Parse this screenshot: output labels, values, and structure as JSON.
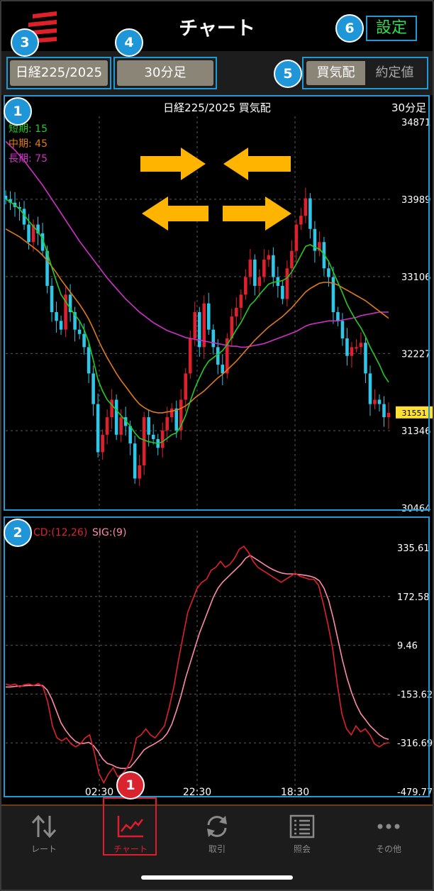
{
  "header": {
    "title": "チャート",
    "settings_label": "設定"
  },
  "toolbar": {
    "symbol_label": "日経225/2025",
    "interval_label": "30分足",
    "segment": {
      "bid_label": "買気配",
      "trade_label": "約定値"
    }
  },
  "badges": {
    "b1": "1",
    "b2": "2",
    "b3": "3",
    "b4": "4",
    "b5": "5",
    "b6": "6",
    "b7": "1"
  },
  "main_chart": {
    "header_title": "日経225/2025 買気配",
    "interval_label": "30分足",
    "ma_labels": {
      "short": "短期: 15",
      "mid": "中期: 45",
      "long": "長期: 75"
    },
    "price_ticks": [
      "34871",
      "33989",
      "33106",
      "32227",
      "31346",
      "30464"
    ],
    "current_price": "31551"
  },
  "macd_chart": {
    "label_macd": "CD:(12,26)",
    "label_sig": "SIG:(9)",
    "value_ticks": [
      "335.61",
      "172.58",
      "9.46",
      "-153.62",
      "-316.69",
      "-479.77"
    ],
    "time_ticks": [
      "02:30",
      "22:30",
      "18:30"
    ]
  },
  "tabs": [
    {
      "label": "レート",
      "icon": "arrows-updown-icon"
    },
    {
      "label": "チャート",
      "icon": "chart-line-icon"
    },
    {
      "label": "取引",
      "icon": "refresh-icon"
    },
    {
      "label": "照会",
      "icon": "list-icon"
    },
    {
      "label": "その他",
      "icon": "more-dots-icon"
    }
  ],
  "colors": {
    "accent_blue": "#1e9ad6",
    "settings_green": "#2edc52",
    "candle_up": "#e0202e",
    "candle_down": "#2ec7e8",
    "ma_short": "#22cc22",
    "ma_mid": "#e07a18",
    "ma_long": "#d030c8",
    "macd": "#e0202e",
    "signal": "#ff8aa8",
    "arrow": "#ffb400",
    "tab_active": "#e11d2d"
  },
  "chart_data": [
    {
      "type": "candlestick",
      "title": "日経225/2025 買気配",
      "ylim": [
        30464,
        34871
      ],
      "yticks": [
        34871,
        33989,
        33106,
        32227,
        31346,
        30464
      ],
      "xticks": [
        "02:30",
        "22:30",
        "18:30"
      ],
      "current_price": 31551,
      "ma_periods": {
        "short": 15,
        "mid": 45,
        "long": 75
      },
      "close": [
        33990,
        33950,
        33900,
        33880,
        33700,
        33500,
        33700,
        33600,
        33400,
        33000,
        32700,
        32600,
        32500,
        32900,
        32700,
        32500,
        32450,
        32300,
        32000,
        31650,
        31100,
        31300,
        31500,
        31700,
        31300,
        31500,
        31400,
        31200,
        30800,
        30950,
        31500,
        31300,
        31250,
        31150,
        31350,
        31500,
        31600,
        31350,
        31700,
        32000,
        32400,
        32700,
        32300,
        32800,
        32500,
        32300,
        32100,
        32000,
        32400,
        32650,
        32750,
        32900,
        33100,
        33300,
        33000,
        33100,
        33300,
        33350,
        33100,
        33000,
        32850,
        33200,
        33400,
        33700,
        33800,
        34000,
        33650,
        33400,
        33500,
        33200,
        33100,
        32700,
        32600,
        32400,
        32200,
        32300,
        32300,
        32350,
        32000,
        31650,
        31700,
        31650,
        31500,
        31550
      ],
      "ma_short": [
        33990,
        33960,
        33920,
        33880,
        33810,
        33740,
        33680,
        33620,
        33540,
        33380,
        33210,
        33050,
        32900,
        32820,
        32740,
        32670,
        32600,
        32500,
        32360,
        32150,
        31930,
        31800,
        31700,
        31640,
        31580,
        31520,
        31460,
        31400,
        31320,
        31260,
        31240,
        31220,
        31210,
        31200,
        31220,
        31260,
        31300,
        31320,
        31400,
        31520,
        31680,
        31830,
        31950,
        32060,
        32140,
        32180,
        32220,
        32260,
        32330,
        32410,
        32500,
        32580,
        32680,
        32780,
        32830,
        32900,
        32960,
        33020,
        33040,
        33050,
        33060,
        33090,
        33160,
        33250,
        33350,
        33450,
        33470,
        33440,
        33420,
        33360,
        33280,
        33160,
        33040,
        32920,
        32790,
        32690,
        32600,
        32520,
        32420,
        32300,
        32200,
        32100,
        31980,
        31900
      ],
      "ma_mid": [
        33650,
        33620,
        33590,
        33560,
        33520,
        33480,
        33440,
        33400,
        33350,
        33290,
        33220,
        33150,
        33070,
        33000,
        32930,
        32860,
        32790,
        32710,
        32620,
        32510,
        32390,
        32280,
        32180,
        32090,
        32000,
        31920,
        31850,
        31780,
        31710,
        31650,
        31610,
        31580,
        31560,
        31550,
        31550,
        31560,
        31570,
        31580,
        31600,
        31630,
        31670,
        31720,
        31760,
        31800,
        31850,
        31900,
        31950,
        31990,
        32040,
        32090,
        32140,
        32200,
        32260,
        32320,
        32380,
        32430,
        32480,
        32530,
        32570,
        32610,
        32650,
        32700,
        32750,
        32810,
        32870,
        32930,
        32970,
        33000,
        33030,
        33040,
        33040,
        33030,
        33010,
        32980,
        32950,
        32920,
        32890,
        32860,
        32830,
        32790,
        32750,
        32710,
        32670,
        32630
      ],
      "ma_long": [
        34650,
        34600,
        34550,
        34490,
        34430,
        34360,
        34290,
        34220,
        34150,
        34070,
        33990,
        33910,
        33830,
        33750,
        33670,
        33590,
        33510,
        33440,
        33370,
        33300,
        33230,
        33160,
        33090,
        33030,
        32970,
        32910,
        32850,
        32800,
        32750,
        32700,
        32660,
        32620,
        32580,
        32550,
        32520,
        32490,
        32470,
        32450,
        32430,
        32410,
        32400,
        32390,
        32380,
        32370,
        32360,
        32350,
        32340,
        32330,
        32320,
        32310,
        32310,
        32300,
        32300,
        32310,
        32320,
        32330,
        32340,
        32360,
        32380,
        32400,
        32420,
        32440,
        32460,
        32480,
        32510,
        32540,
        32560,
        32570,
        32580,
        32590,
        32600,
        32600,
        32600,
        32610,
        32620,
        32630,
        32640,
        32660,
        32670,
        32680,
        32690,
        32700,
        32700,
        32700
      ]
    },
    {
      "type": "line",
      "title": "MACD(12,26) SIG(9)",
      "ylim": [
        -479.77,
        335.61
      ],
      "yticks": [
        335.61,
        172.58,
        9.46,
        -153.62,
        -316.69,
        -479.77
      ],
      "xticks": [
        "02:30",
        "22:30",
        "18:30"
      ],
      "series": [
        {
          "name": "MACD",
          "values": [
            -120,
            -125,
            -120,
            -130,
            -122,
            -120,
            -125,
            -118,
            -130,
            -180,
            -260,
            -300,
            -310,
            -300,
            -320,
            -330,
            -320,
            -300,
            -290,
            -350,
            -420,
            -450,
            -420,
            -400,
            -430,
            -420,
            -400,
            -370,
            -300,
            -290,
            -270,
            -290,
            -300,
            -280,
            -260,
            -200,
            -130,
            -40,
            40,
            120,
            160,
            200,
            220,
            230,
            260,
            270,
            290,
            270,
            280,
            300,
            330,
            340,
            320,
            290,
            270,
            260,
            250,
            240,
            230,
            220,
            230,
            240,
            250,
            240,
            235,
            230,
            230,
            210,
            150,
            80,
            0,
            -120,
            -220,
            -270,
            -290,
            -260,
            -280,
            -270,
            -290,
            -320,
            -330,
            -320,
            -316
          ]
        },
        {
          "name": "SIG",
          "values": [
            -130,
            -130,
            -128,
            -127,
            -126,
            -125,
            -125,
            -124,
            -125,
            -140,
            -170,
            -210,
            -250,
            -275,
            -295,
            -310,
            -318,
            -318,
            -315,
            -325,
            -345,
            -370,
            -385,
            -390,
            -398,
            -402,
            -402,
            -398,
            -380,
            -360,
            -340,
            -330,
            -322,
            -313,
            -303,
            -285,
            -255,
            -210,
            -160,
            -100,
            -50,
            0,
            50,
            90,
            130,
            170,
            200,
            220,
            235,
            250,
            265,
            280,
            300,
            310,
            300,
            290,
            280,
            270,
            262,
            255,
            250,
            248,
            248,
            247,
            245,
            243,
            240,
            235,
            225,
            200,
            160,
            100,
            30,
            -40,
            -100,
            -150,
            -190,
            -220,
            -240,
            -260,
            -275,
            -290,
            -300,
            -305
          ]
        }
      ]
    }
  ]
}
